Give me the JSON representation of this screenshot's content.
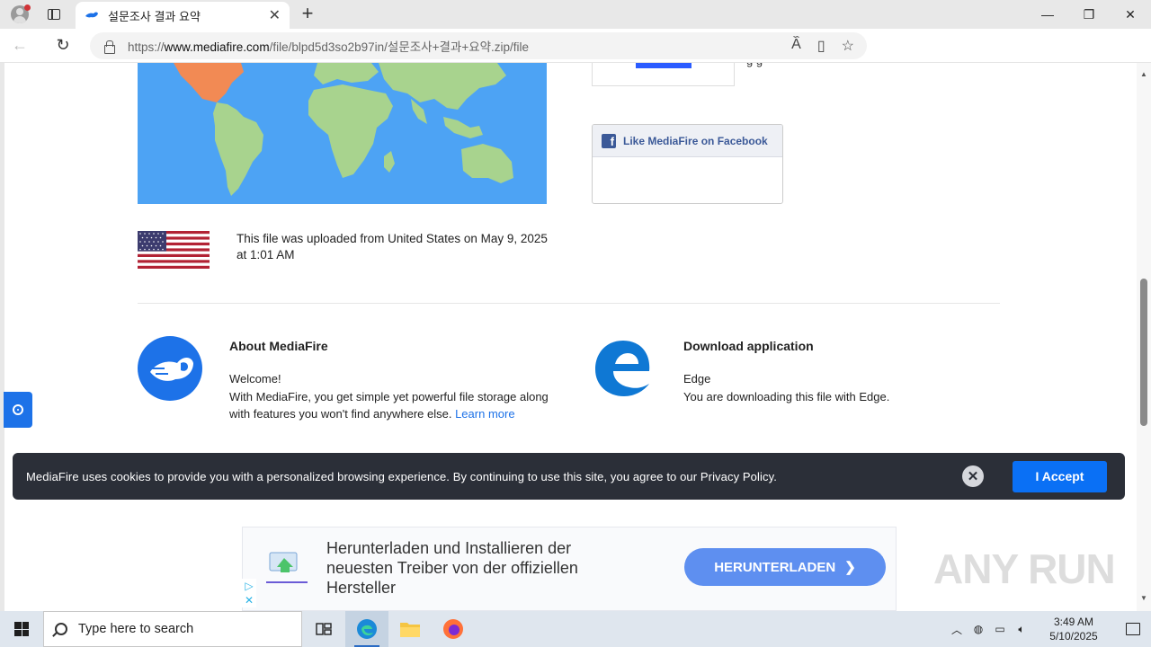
{
  "browser": {
    "tab_title": "설문조사 결과 요약",
    "url_prefix": "https://",
    "url_host": "www.mediafire.com",
    "url_path": "/file/blpd5d3so2b97in/설문조사+결과+요약.zip/file",
    "new_tab_label": "+",
    "tab_close_label": "✕",
    "back_label": "←",
    "refresh_label": "↻",
    "min_label": "—",
    "max_label": "❐",
    "close_label": "✕",
    "more_label": "⋯"
  },
  "page": {
    "fb_snippet": "g        g",
    "fb_like_label": "Like MediaFire on Facebook",
    "fb_icon_letter": "f",
    "upload_info": "This file was uploaded from United States on May 9, 2025 at 1:01 AM",
    "about": {
      "title": "About MediaFire",
      "welcome": "Welcome!",
      "body": "With MediaFire, you get simple yet powerful file storage along with features you won't find anywhere else.",
      "link": "Learn more"
    },
    "download": {
      "title": "Download application",
      "app": "Edge",
      "body": "You are downloading this file with Edge."
    }
  },
  "cookie": {
    "message": "MediaFire uses cookies to provide you with a personalized browsing experience. By continuing to use this site, you agree to our Privacy Policy.",
    "close_label": "✕",
    "accept_label": "I Accept"
  },
  "ad": {
    "text": "Herunterladen und Installieren der neuesten Treiber von der offiziellen Hersteller",
    "cta": "HERUNTERLADEN",
    "adchoice_play": "▷",
    "adchoice_close": "✕"
  },
  "watermark": "ANY RUN",
  "taskbar": {
    "search_placeholder": "Type here to search",
    "time": "3:49 AM",
    "date": "5/10/2025"
  },
  "colors": {
    "mediafire_blue": "#1d72e8",
    "cookie_bg": "#2b2f38",
    "accept_blue": "#0a70f5",
    "facebook_blue": "#3b5998",
    "ocean": "#4da3f4",
    "land": "#a8d38e",
    "north_america": "#f28a54"
  }
}
